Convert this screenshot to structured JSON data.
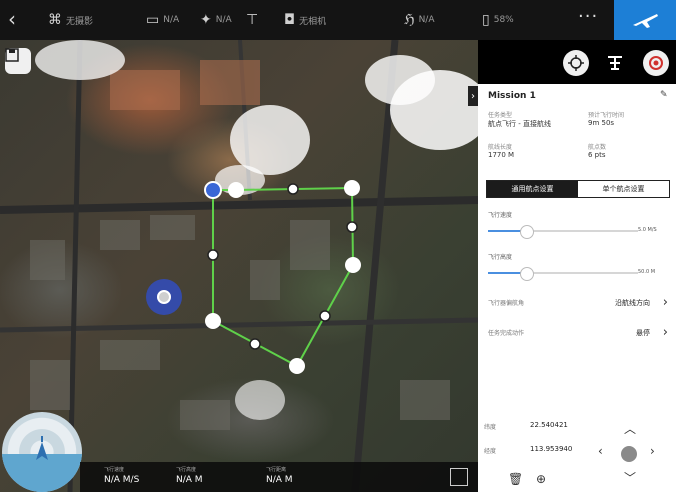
{
  "topbar": {
    "items": [
      {
        "icon": "flight-mode-icon",
        "label": "无摄影"
      },
      {
        "icon": "battery-icon",
        "label": "N/A"
      },
      {
        "icon": "satellite-icon",
        "label": "N/A"
      },
      {
        "icon": "remote-controller-icon",
        "label": ""
      },
      {
        "icon": "camera-icon",
        "label": "无相机"
      },
      {
        "icon": "signal-icon",
        "label": "N/A"
      },
      {
        "icon": "phone-battery-icon",
        "label": "58%"
      }
    ],
    "more_label": "···"
  },
  "mission": {
    "title": "Mission 1",
    "task_type_label": "任务类型",
    "task_type_value": "航点飞行 - 直接航线",
    "flight_time_label": "预计飞行时间",
    "flight_time_value": "9m 50s",
    "route_length_label": "航线长度",
    "route_length_value": "1770 M",
    "waypoints_label": "航点数",
    "waypoints_value": "6 pts"
  },
  "tabs": {
    "general": "通用航点设置",
    "single": "单个航点设置"
  },
  "speed": {
    "label": "飞行速度",
    "value_text": "5.0 M/S",
    "fraction": 0.25
  },
  "altitude": {
    "label": "飞行高度",
    "value_text": "50.0 M",
    "fraction": 0.25
  },
  "heading": {
    "label": "飞行器偏航角",
    "value": "沿航线方向"
  },
  "finish": {
    "label": "任务完成动作",
    "value": "悬停"
  },
  "coords": {
    "lat_label": "纬度",
    "lat_value": "22.540421",
    "lon_label": "经度",
    "lon_value": "113.953940"
  },
  "telemetry": {
    "speed_label": "飞行速度",
    "speed_value": "N/A M/S",
    "alt_label": "飞行高度",
    "alt_value": "N/A M",
    "dist_label": "飞行距离",
    "dist_value": "N/A M"
  },
  "colors": {
    "accent": "#1d7fd6",
    "route": "#5fd14a"
  }
}
